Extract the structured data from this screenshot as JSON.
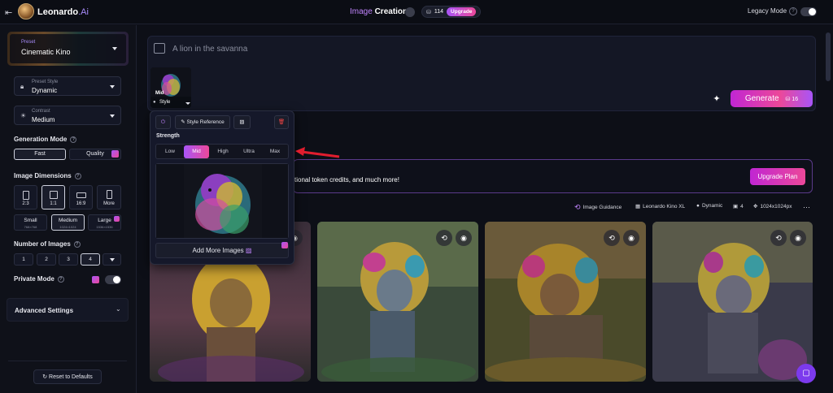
{
  "app": {
    "brand": "Leonardo",
    "brand_suffix": ".Ai"
  },
  "header": {
    "title_a": "Image",
    "title_b": "Creation",
    "tokens": "114",
    "upgrade_label": "Upgrade",
    "legacy_label": "Legacy Mode"
  },
  "sidebar": {
    "preset_label": "Preset",
    "preset_value": "Cinematic Kino",
    "preset_style_label": "Preset Style",
    "preset_style_value": "Dynamic",
    "contrast_label": "Contrast",
    "contrast_value": "Medium",
    "generation_mode_title": "Generation Mode",
    "mode_fast": "Fast",
    "mode_quality": "Quality",
    "image_dimensions_title": "Image Dimensions",
    "ratios": [
      "2:3",
      "1:1",
      "16:9",
      "More"
    ],
    "sizes": [
      {
        "label": "Small",
        "sub": "768×768"
      },
      {
        "label": "Medium",
        "sub": "1024×1024"
      },
      {
        "label": "Large",
        "sub": "1536×1536"
      }
    ],
    "number_images_title": "Number of Images",
    "counts": [
      "1",
      "2",
      "3",
      "4"
    ],
    "private_mode_label": "Private Mode",
    "advanced_label": "Advanced Settings",
    "reset_label": "Reset to Defaults"
  },
  "prompt": {
    "text": "A lion in the savanna"
  },
  "style_thumb": {
    "badge": "Mid",
    "label": "Style"
  },
  "generate": {
    "label": "Generate",
    "cost": "16"
  },
  "popup": {
    "style_reference": "Style Reference",
    "strength_label": "Strength",
    "levels": [
      "Low",
      "Mid",
      "High",
      "Ultra",
      "Max"
    ],
    "selected_level": "Mid",
    "add_more": "Add More Images"
  },
  "banner": {
    "text": "tional token credits, and much more!",
    "button": "Upgrade Plan"
  },
  "meta": {
    "guidance": "Image Guidance",
    "model": "Leonardo Kino XL",
    "style": "Dynamic",
    "count": "4",
    "size": "1024x1024px"
  },
  "colors": {
    "accent": "#a855f7",
    "accent2": "#ec4899",
    "bg": "#0d0f17",
    "panel": "#141725"
  }
}
